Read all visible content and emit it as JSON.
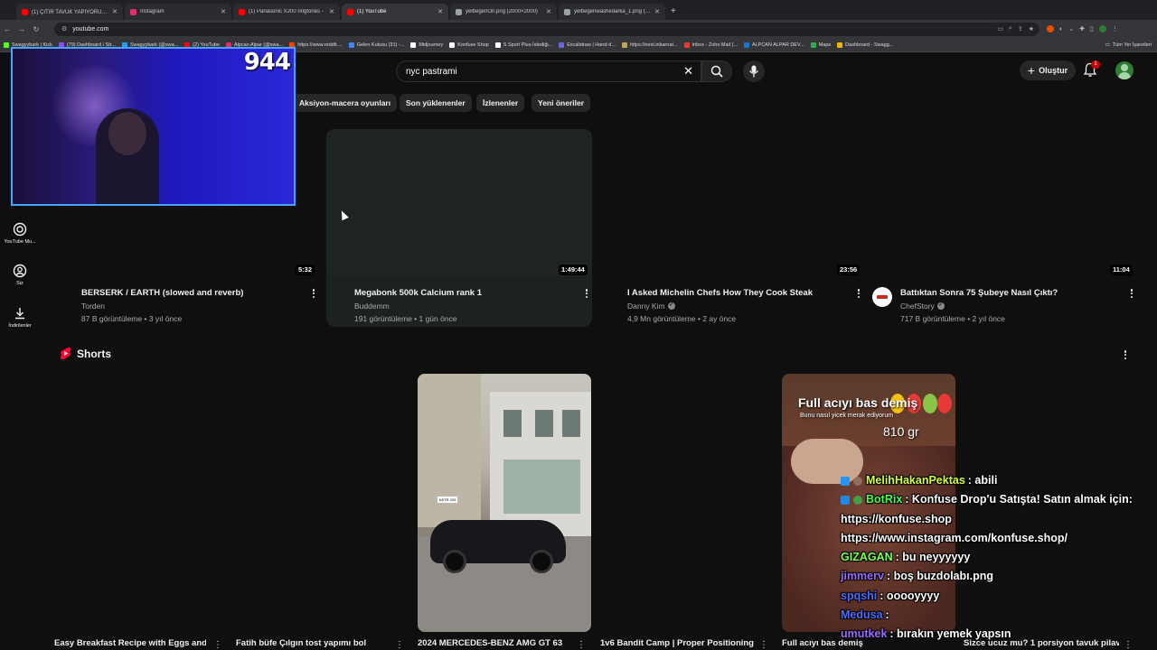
{
  "browser": {
    "tabs": [
      {
        "title": "(1) ÇITIR TAVUK YAPIYORUZ 🍗",
        "favicon_color": "#ff0000"
      },
      {
        "title": "Instagram",
        "favicon_color": "#e1306c"
      },
      {
        "title": "(1) Panasonic X200 ringtones -",
        "favicon_color": "#ff0000"
      },
      {
        "title": "(1) YouTube",
        "favicon_color": "#ff0000",
        "active": true
      },
      {
        "title": "yelbegenOn.png (2000×2000)",
        "favicon_color": "#9aa0a6"
      },
      {
        "title": "yelbegenwashedarka_1.png (2...",
        "favicon_color": "#9aa0a6"
      }
    ],
    "url": "youtube.com",
    "bookmarks": [
      "Swagyybark | Kick",
      "(79) Dashboard / Str...",
      "Swagyybark (@swa...",
      "(2) YouTube",
      "Alpcan Alpar (@swa...",
      "https://www.reddit....",
      "Gelen Kutusu (31) -...",
      "Midjourney",
      "Konfuse Shop",
      "S Sport Plus-İstediği...",
      "Excalidraw | Hand-d...",
      "https://next.inkarnat...",
      "Inbox - Zoho Mail (...",
      "ALPCAN ALPAR DEV...",
      "Maps",
      "Dashboard - Swagg..."
    ],
    "bookmarks_all": "Tüm Yer İşaretleri"
  },
  "youtube": {
    "search_query": "nyc pastrami",
    "create_label": "Oluştur",
    "notification_count": "1",
    "chips": [
      "Aksiyon-macera oyunları",
      "Son yüklenenler",
      "İzlenenler",
      "Yeni öneriler"
    ],
    "sidenav": [
      {
        "label": "YouTube Mu...",
        "icon": "music-icon"
      },
      {
        "label": "Siz",
        "icon": "user-icon"
      },
      {
        "label": "İndirilenler",
        "icon": "download-icon"
      }
    ],
    "videos": [
      {
        "title": "BERSERK / EARTH (slowed and reverb)",
        "channel": "Torden",
        "verified": false,
        "meta": "87 B görüntüleme • 3 yıl önce",
        "duration": "5:32"
      },
      {
        "title": "Megabonk 500k Calcium rank 1",
        "channel": "Buddemm",
        "verified": false,
        "meta": "191 görüntüleme • 1 gün önce",
        "duration": "1:49:44"
      },
      {
        "title": "I Asked Michelin Chefs How They Cook Steak",
        "channel": "Danny Kim",
        "verified": true,
        "meta": "4,9 Mn görüntüleme • 2 ay önce",
        "duration": "23:56"
      },
      {
        "title": "Battıktan Sonra 75 Şubeye Nasıl Çıktı?",
        "channel": "ChefStory",
        "verified": true,
        "meta": "717 B görüntüleme • 2 yıl önce",
        "duration": "11:04"
      }
    ],
    "shorts_label": "Shorts",
    "shorts": [
      {
        "title": "Easy Breakfast Recipe with Eggs and"
      },
      {
        "title": "Fatih büfe Çılgın tost yapımı bol"
      },
      {
        "title": "2024 MERCEDES-BENZ AMG GT 63"
      },
      {
        "title": "1v6 Bandit Camp | Proper Positioning"
      },
      {
        "title": "Full acıyı bas demiş"
      },
      {
        "title": "Sizce ucuz mu? 1 porsiyon tavuk pilav"
      }
    ],
    "short_overlay": {
      "headline": "Full acıyı bas demiş",
      "subline": "Bunu nasıl yicek merak ediyorum",
      "weight": "810 gr"
    },
    "short_car_plate": "NSTR 333"
  },
  "stream": {
    "viewer_count": "944",
    "chat": [
      {
        "user": "MelihHakanPektas",
        "user_color": "#d4ff3a",
        "text": ": abili"
      },
      {
        "user": "BotRix",
        "user_color": "#4cff4c",
        "text": ": Konfuse Drop'u Satışta! Satın almak için:"
      },
      {
        "user": "",
        "user_color": "#ffffff",
        "text": "https://konfuse.shop"
      },
      {
        "user": "",
        "user_color": "#ffffff",
        "text": "https://www.instagram.com/konfuse.shop/"
      },
      {
        "user": "GIZAGAN",
        "user_color": "#7cff4c",
        "text": ": bu neyyyyyy"
      },
      {
        "user": "jimmerv",
        "user_color": "#9b6bff",
        "text": ": boş buzdolabı.png"
      },
      {
        "user": "spqshi",
        "user_color": "#4a6cff",
        "text": ": ooooyyyy"
      },
      {
        "user": "Medusa",
        "user_color": "#4a6cff",
        "text": ":"
      },
      {
        "user": "umutkek",
        "user_color": "#9b6bff",
        "text": ": bırakın yemek yapsın"
      }
    ]
  }
}
